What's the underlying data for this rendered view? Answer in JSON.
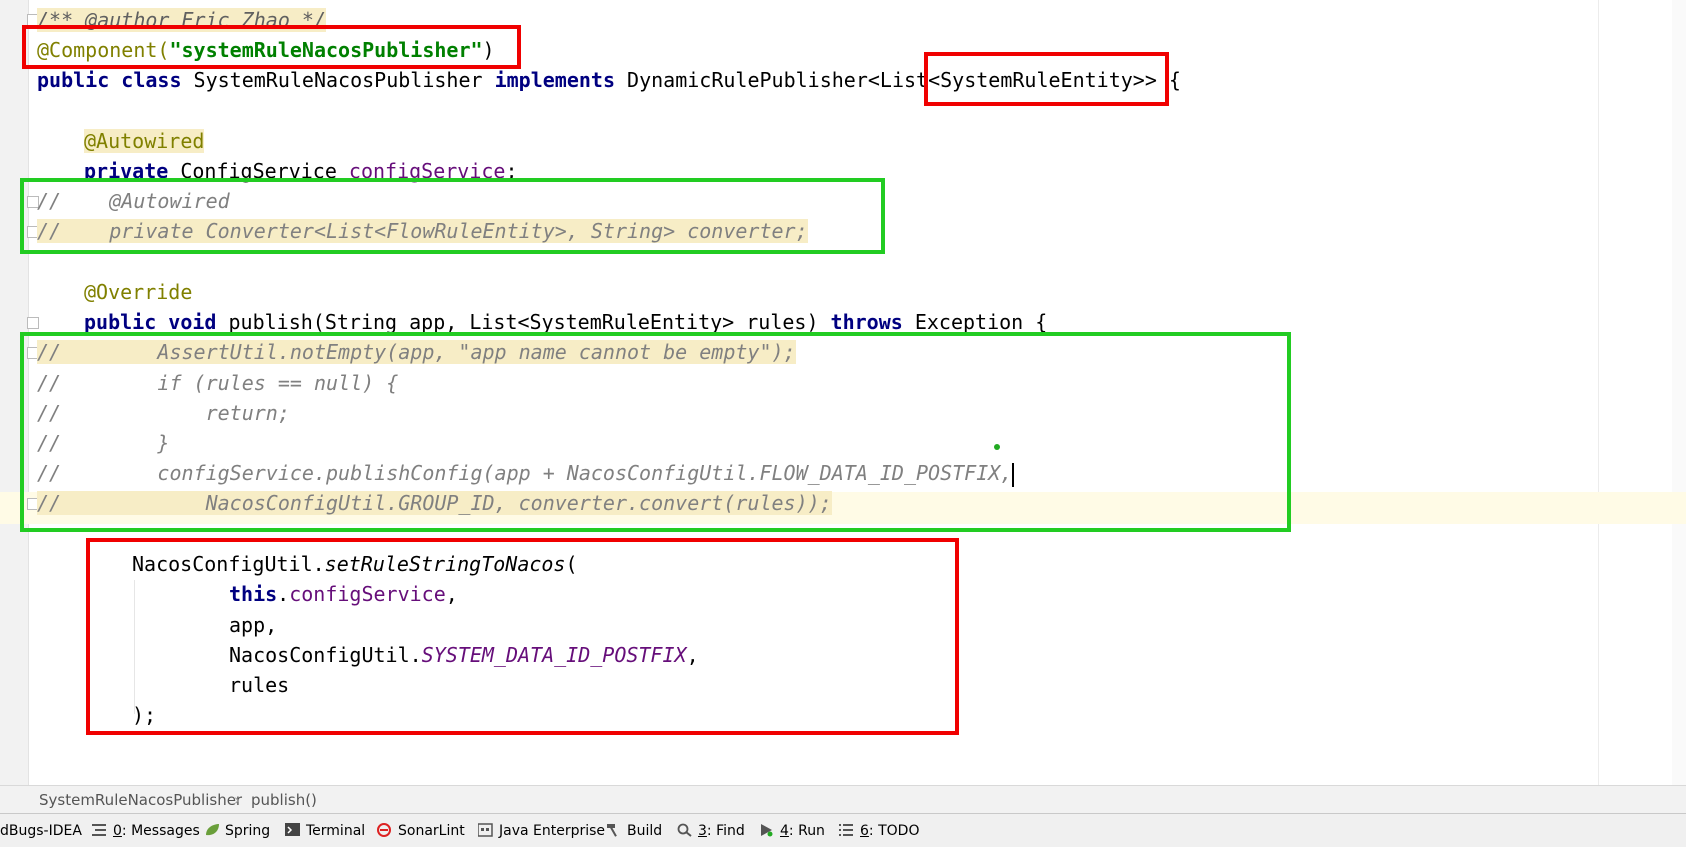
{
  "editor": {
    "lines": {
      "l0": "/** @author Eric Zhao */",
      "l1_ann": "@Component(",
      "l1_str": "\"systemRuleNacosPublisher\"",
      "l1_close": ")",
      "l2_kw1": "public class",
      "l2_text": " SystemRuleNacosPublisher ",
      "l2_kw2": "implements",
      "l2_text2": " DynamicRulePublisher<List",
      "l2_generic": "<SystemRuleEntity>>",
      "l2_brace": " {",
      "l4_ann": "@Autowired",
      "l5_kw": "private",
      "l5_type": " ConfigService ",
      "l5_field": "configService",
      "l5_semi": ";",
      "l6": "//    @Autowired",
      "l7": "//    private Converter<List<FlowRuleEntity>, String> converter;",
      "l9_ann": "@Override",
      "l10_kw1": "public void",
      "l10_text": " publish(String app, List<SystemRuleEntity> rules) ",
      "l10_kw2": "throws",
      "l10_text2": " Exception {",
      "l11": "//        AssertUtil.notEmpty(app, \"app name cannot be empty\");",
      "l12": "//        if (rules == null) {",
      "l13": "//            return;",
      "l14": "//        }",
      "l15": "//        configService.publishConfig(app + NacosConfigUtil.FLOW_DATA_ID_POSTFIX,",
      "l16": "//            NacosConfigUtil.GROUP_ID, converter.convert(rules));",
      "l18_text": "NacosConfigUtil.",
      "l18_method": "setRuleStringToNacos",
      "l18_paren": "(",
      "l19_kw": "this",
      "l19_dot": ".",
      "l19_field": "configService",
      "l19_comma": ",",
      "l20": "app,",
      "l21_text": "NacosConfigUtil.",
      "l21_const": "SYSTEM_DATA_ID_POSTFIX",
      "l21_comma": ",",
      "l22": "rules",
      "l23": ");"
    }
  },
  "breadcrumbs": {
    "class_name": "SystemRuleNacosPublisher",
    "separator": "›",
    "method_name": "publish()"
  },
  "toolbar": {
    "findbugs": "dBugs-IDEA",
    "messages_num": "0",
    "messages_label": ": Messages",
    "spring": "Spring",
    "terminal": "Terminal",
    "sonarlint": "SonarLint",
    "java_enterprise": "Java Enterprise",
    "build": "Build",
    "find_num": "3",
    "find_label": ": Find",
    "run_num": "4",
    "run_label": ": Run",
    "todo_num": "6",
    "todo_label": ": TODO"
  },
  "colors": {
    "red_box": "#f00000",
    "green_box": "#22cc22",
    "keyword": "#000080",
    "annotation": "#808000",
    "string": "#008000",
    "field": "#660e7a",
    "comment": "#808080"
  }
}
